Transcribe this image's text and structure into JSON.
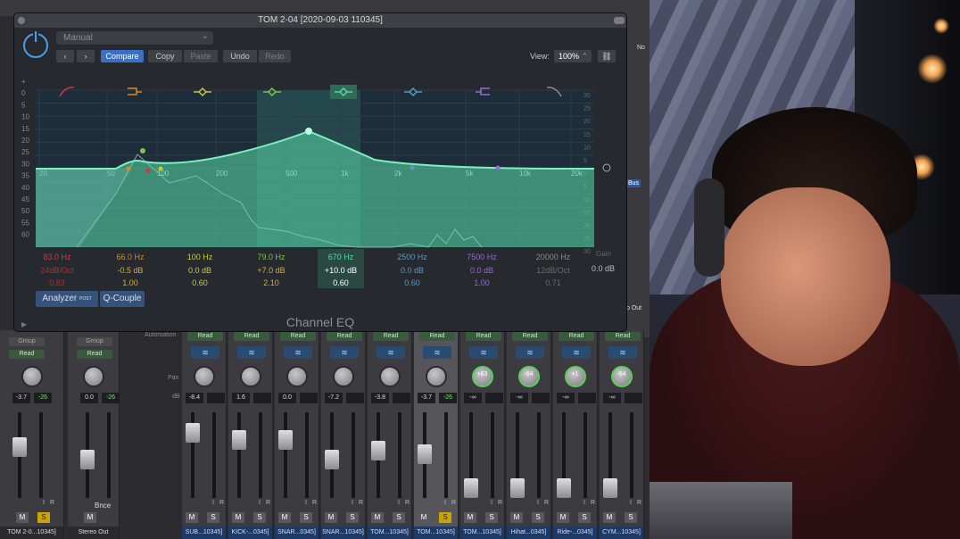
{
  "window": {
    "title": "TOM 2-04 [2020-09-03 110345]",
    "plugin_name": "Channel EQ"
  },
  "toolbar": {
    "preset": "Manual",
    "compare": "Compare",
    "copy": "Copy",
    "paste": "Paste",
    "undo": "Undo",
    "redo": "Redo",
    "view_label": "View:",
    "zoom": "100%"
  },
  "freq_ticks": [
    "20",
    "50",
    "100",
    "200",
    "500",
    "1k",
    "2k",
    "5k",
    "10k",
    "20k"
  ],
  "db_ticks_left": [
    "+",
    "0",
    "5",
    "10",
    "15",
    "20",
    "25",
    "30",
    "35",
    "40",
    "45",
    "50",
    "55",
    "60"
  ],
  "db_ticks_right": [
    "30",
    "25",
    "20",
    "15",
    "10",
    "5",
    "0",
    "5",
    "10",
    "15",
    "20",
    "25",
    "30"
  ],
  "bands": [
    {
      "freq": "83.0 Hz",
      "gain": "24dB/Oct",
      "q": "0.83",
      "color": "#d03a3a"
    },
    {
      "freq": "66.0 Hz",
      "gain": "-0.5 dB",
      "q": "1.00",
      "color": "#d88a2a"
    },
    {
      "freq": "100 Hz",
      "gain": "0.0 dB",
      "q": "0.60",
      "color": "#c8c83a"
    },
    {
      "freq": "79.0 Hz",
      "gain": "+7.0 dB",
      "q": "2.10",
      "color": "#7ac84a"
    },
    {
      "freq": "670 Hz",
      "gain": "+10.0 dB",
      "q": "0.60",
      "color": "#5ad8a0"
    },
    {
      "freq": "2500 Hz",
      "gain": "0.0 dB",
      "q": "0.60",
      "color": "#5a9ac8"
    },
    {
      "freq": "7500 Hz",
      "gain": "0.0 dB",
      "q": "1.00",
      "color": "#9a6ad8"
    },
    {
      "freq": "20000 Hz",
      "gain": "12dB/Oct",
      "q": "0.71",
      "color": "#8a8a8a"
    }
  ],
  "gain": {
    "label": "Gain",
    "value": "0.0 dB"
  },
  "bottom": {
    "analyzer": "Analyzer",
    "analyzer_tag": "POST",
    "qcouple": "Q-Couple"
  },
  "mixer": {
    "group_label": "Group",
    "read_label": "Read",
    "pan_label": "Pan",
    "db_label": "dB",
    "automation_label": "Automation",
    "mute": "M",
    "solo": "S",
    "bnce": "Bnce",
    "input_mon": "I",
    "rec": "R",
    "right_labels": [
      "No",
      "Bus",
      "Output",
      "o Out"
    ],
    "strips": [
      {
        "name": "TOM 2-0...10345]",
        "pan": "",
        "db1": "-3.7",
        "db2": "-26"
      },
      {
        "name": "Stereo Out",
        "pan": "",
        "db1": "0.0",
        "db2": "-26"
      },
      {
        "name": "SUB...10345]",
        "pan": "",
        "db1": "-8.4",
        "db2": ""
      },
      {
        "name": "KICK-...0345]",
        "pan": "",
        "db1": "1.6",
        "db2": ""
      },
      {
        "name": "SNAR...0345]",
        "pan": "",
        "db1": "0.0",
        "db2": ""
      },
      {
        "name": "SNAR...10345]",
        "pan": "",
        "db1": "-7.2",
        "db2": ""
      },
      {
        "name": "TOM...10345]",
        "pan": "",
        "db1": "-3.8",
        "db2": ""
      },
      {
        "name": "TOM...10345]",
        "pan": "",
        "db1": "-3.7",
        "db2": "-26"
      },
      {
        "name": "TOM...10345]",
        "pan": "+63",
        "db1": "-∞",
        "db2": ""
      },
      {
        "name": "Hihat...0345]",
        "pan": "-64",
        "db1": "-∞",
        "db2": ""
      },
      {
        "name": "Ride-...0345]",
        "pan": "+1",
        "db1": "-∞",
        "db2": ""
      },
      {
        "name": "CYM...10345]",
        "pan": "-64",
        "db1": "-∞",
        "db2": ""
      }
    ]
  }
}
